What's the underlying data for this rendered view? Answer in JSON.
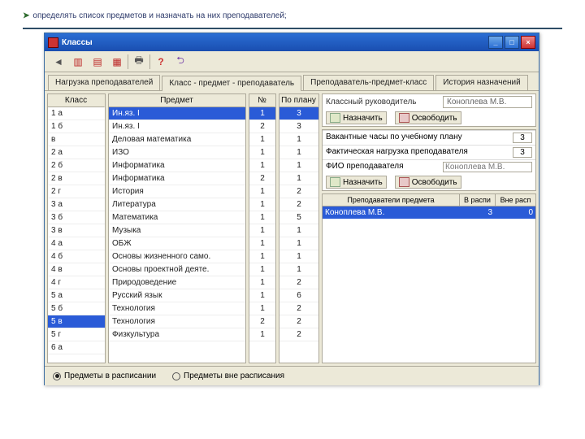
{
  "heading": "определять список предметов и назначать на них преподавателей;",
  "window": {
    "title": "Классы",
    "min": "_",
    "max": "□",
    "close": "×"
  },
  "toolbar_icons": [
    "arrow",
    "doc1",
    "doc2",
    "doc3",
    "sep",
    "print",
    "sep",
    "help",
    "exit"
  ],
  "tabs": [
    "Нагрузка преподавателей",
    "Класс - предмет - преподаватель",
    "Преподаватель-предмет-класс",
    "История назначений"
  ],
  "active_tab": 1,
  "headers": {
    "klass": "Класс",
    "predmet": "Предмет",
    "num": "№",
    "plan": "По плану"
  },
  "klasses": [
    "1 а",
    "1 б",
    "в",
    "2 а",
    "2 б",
    "2 в",
    "2 г",
    "3 а",
    "3 б",
    "3 в",
    "4 а",
    "4 б",
    "4 в",
    "4 г",
    "5 а",
    "5 б",
    "5 в",
    "5 г",
    "6 а"
  ],
  "klass_selected": 16,
  "subjects": [
    {
      "name": "Ин.яз. I",
      "n": "1",
      "plan": "3",
      "sel": true
    },
    {
      "name": "Ин.яз. I",
      "n": "2",
      "plan": "3"
    },
    {
      "name": "Деловая математика",
      "n": "1",
      "plan": "1"
    },
    {
      "name": "ИЗО",
      "n": "1",
      "plan": "1"
    },
    {
      "name": "Информатика",
      "n": "1",
      "plan": "1"
    },
    {
      "name": "Информатика",
      "n": "2",
      "plan": "1"
    },
    {
      "name": "История",
      "n": "1",
      "plan": "2"
    },
    {
      "name": "Литература",
      "n": "1",
      "plan": "2"
    },
    {
      "name": "Математика",
      "n": "1",
      "plan": "5"
    },
    {
      "name": "Музыка",
      "n": "1",
      "plan": "1"
    },
    {
      "name": "ОБЖ",
      "n": "1",
      "plan": "1"
    },
    {
      "name": "Основы жизненного само.",
      "n": "1",
      "plan": "1"
    },
    {
      "name": "Основы проектной деяте.",
      "n": "1",
      "plan": "1"
    },
    {
      "name": "Природоведение",
      "n": "1",
      "plan": "2"
    },
    {
      "name": "Русский язык",
      "n": "1",
      "plan": "6"
    },
    {
      "name": "Технология",
      "n": "1",
      "plan": "2"
    },
    {
      "name": "Технология",
      "n": "2",
      "plan": "2"
    },
    {
      "name": "Физкультура",
      "n": "1",
      "plan": "2"
    }
  ],
  "right": {
    "class_teacher_label": "Классный руководитель",
    "class_teacher_value": "Коноплева М.В.",
    "assign": "Назначить",
    "release": "Освободить",
    "vacant_label": "Вакантные часы по учебному плану",
    "vacant_value": "3",
    "actual_label": "Фактическая нагрузка преподавателя",
    "actual_value": "3",
    "fio_label": "ФИО преподавателя",
    "fio_value": "Коноплева М.В.",
    "teachers_header": "Преподаватели предмета",
    "col_in": "В распи",
    "col_out": "Вне расп",
    "teacher_rows": [
      {
        "name": "Коноплева М.В.",
        "in": "3",
        "out": "0",
        "sel": true
      }
    ]
  },
  "bottom": {
    "r1": "Предметы в расписании",
    "r2": "Предметы вне расписания",
    "selected": 0
  }
}
